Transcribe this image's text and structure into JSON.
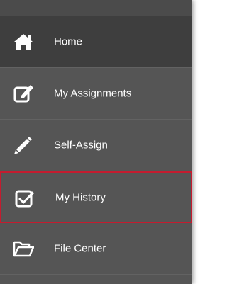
{
  "nav": {
    "items": [
      {
        "label": "Home",
        "icon": "home-icon"
      },
      {
        "label": "My Assignments",
        "icon": "edit-square-icon"
      },
      {
        "label": "Self-Assign",
        "icon": "pencil-icon"
      },
      {
        "label": "My History",
        "icon": "checkbox-checked-icon"
      },
      {
        "label": "File Center",
        "icon": "folder-open-icon"
      }
    ]
  },
  "colors": {
    "panel": "#555555",
    "active_item": "#3e3e3e",
    "highlight_border": "#c41c2f",
    "text": "#ffffff"
  }
}
